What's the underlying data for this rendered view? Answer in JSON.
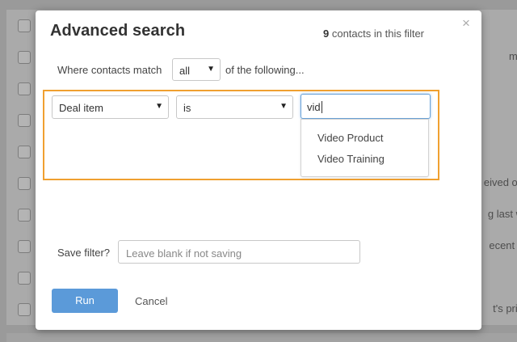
{
  "background": {
    "snippets": [
      "mo",
      "eived ou",
      "g last w",
      "ecent n",
      "t's prin"
    ]
  },
  "modal": {
    "title": "Advanced search",
    "count": "9",
    "count_suffix": " contacts in this filter",
    "close_icon": "×",
    "match_prefix": "Where contacts match",
    "match_value": "all",
    "match_suffix": "of the following...",
    "rule": {
      "field": "Deal item",
      "operator": "is",
      "value": "vid",
      "suggestions": [
        "Video Product",
        "Video Training"
      ]
    },
    "save_label": "Save filter?",
    "save_placeholder": "Leave blank if not saving",
    "run_label": "Run",
    "cancel_label": "Cancel"
  },
  "colors": {
    "accent": "#5b9ad9",
    "rule_border": "#f0a030"
  },
  "icons": {
    "caret": "caret-down-icon",
    "close": "close-icon"
  }
}
